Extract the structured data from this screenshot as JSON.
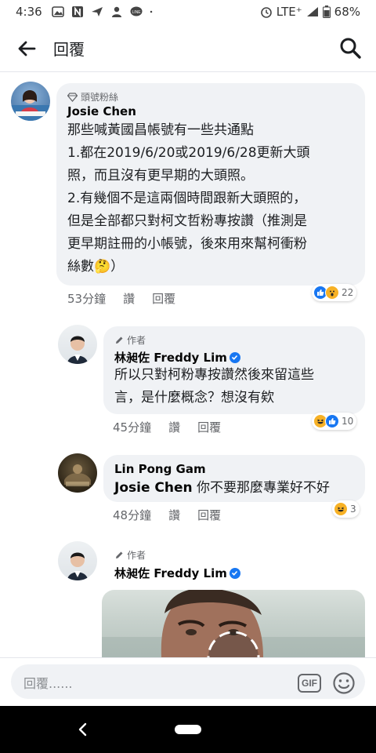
{
  "status_bar": {
    "time": "4:36",
    "network": "LTE⁺",
    "battery": "68%",
    "notification_icons": [
      "gallery-icon",
      "n-icon",
      "send-icon",
      "user-icon",
      "line-icon",
      "dot-icon"
    ]
  },
  "header": {
    "title": "回覆"
  },
  "comments": [
    {
      "badge": "頭號粉絲",
      "author": "Josie Chen",
      "lines": [
        "那些喊黃國昌帳號有一些共通點",
        "1.都在2019/6/20或2019/6/28更新大頭",
        "照，而且沒有更早期的大頭照。",
        "2.有幾個不是這兩個時間跟新大頭照的，",
        "但是全部都只對柯文哲粉專按讚（推測是",
        "更早期註冊的小帳號，後來用來幫柯衝粉",
        "絲數🤔）"
      ],
      "time": "53分鐘",
      "like_label": "讚",
      "reply_label": "回覆",
      "reaction_count": "22"
    },
    {
      "badge": "作者",
      "author": "林昶佐 Freddy Lim",
      "lines": [
        "所以只對柯粉專按讚然後來留這些",
        "言，是什麼概念？想沒有欸"
      ],
      "time": "45分鐘",
      "like_label": "讚",
      "reply_label": "回覆",
      "reaction_count": "10"
    },
    {
      "author": "Lin Pong Gam",
      "tag": "Josie Chen",
      "text": "你不要那麼專業好不好",
      "time": "48分鐘",
      "like_label": "讚",
      "reply_label": "回覆",
      "reaction_count": "3"
    },
    {
      "badge": "作者",
      "author": "林昶佐 Freddy Lim"
    }
  ],
  "composer": {
    "placeholder": "回覆......",
    "gif_label": "GIF"
  },
  "colors": {
    "accent": "#1877f2",
    "bubble": "#f0f2f5",
    "meta_text": "#65676b",
    "haha_yellow": "#f7b125"
  }
}
